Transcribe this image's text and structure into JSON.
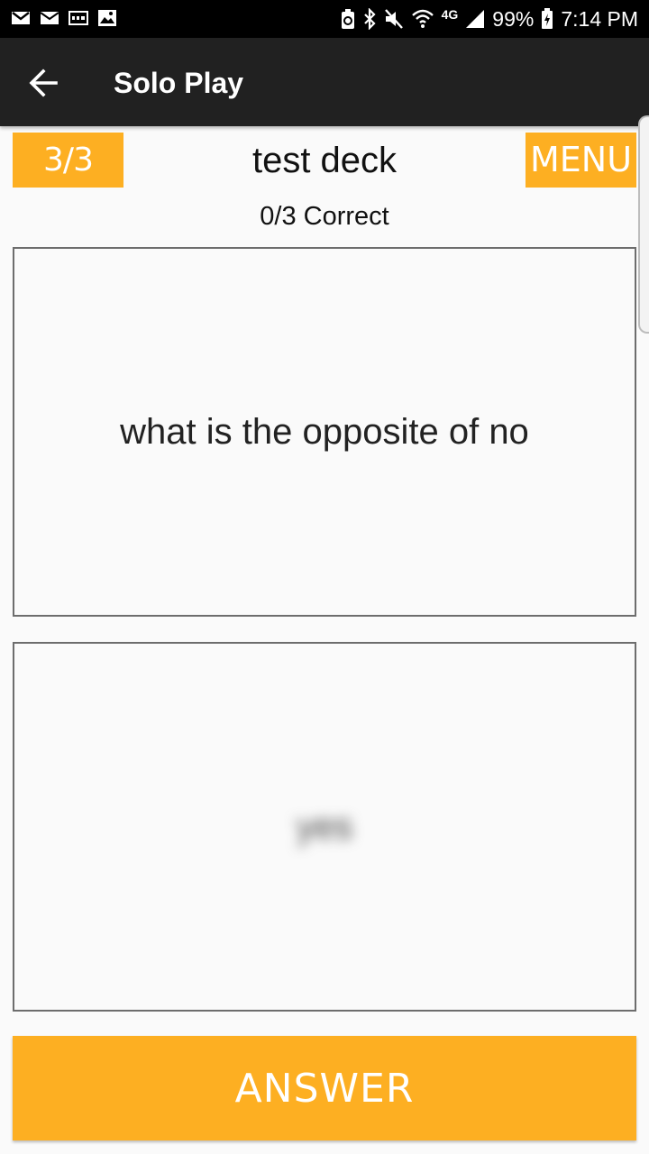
{
  "status_bar": {
    "left_icons": [
      "gmail-icon",
      "email-icon",
      "voicemail-icon",
      "image-icon"
    ],
    "right_icons": [
      "battery-saver-icon",
      "bluetooth-icon",
      "mute-icon",
      "wifi-icon",
      "signal-icon"
    ],
    "network": "4G",
    "battery": "99%",
    "time": "7:14 PM"
  },
  "app_bar": {
    "title": "Solo Play",
    "back_icon": "arrow-left-icon"
  },
  "game": {
    "progress": "3/3",
    "deck_name": "test deck",
    "menu_label": "MENU",
    "score": "0/3 Correct"
  },
  "question": {
    "text": "what is the opposite of no"
  },
  "answer": {
    "hidden_text": "yes",
    "button_label": "ANSWER"
  },
  "colors": {
    "accent": "#fdaf22",
    "app_bar": "#212121",
    "background": "#fafafa"
  }
}
